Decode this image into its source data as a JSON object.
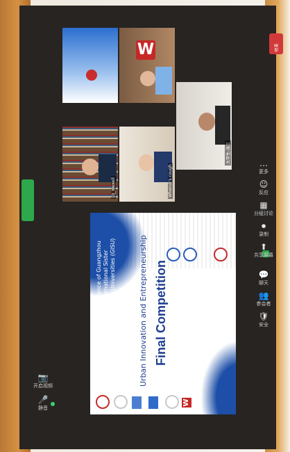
{
  "slide": {
    "host_line1": "Alliance of Guangzhou",
    "host_line2": "International Sister",
    "host_line3": "City Universities (GISU)",
    "title_line1": "Urban Innovation and Entrepreneurship",
    "title_line2": "Final Competition"
  },
  "participants": [
    {
      "name": "DJ_Wexell"
    },
    {
      "name": "Whendi's cough"
    },
    {
      "name": "大学生-张三"
    }
  ],
  "toolbar": {
    "items": [
      {
        "glyph": "🎤",
        "label": "静音"
      },
      {
        "glyph": "📷",
        "label": "开启视频"
      },
      {
        "glyph": "🛡",
        "label": "安全"
      },
      {
        "glyph": "👥",
        "label": "参会者"
      },
      {
        "glyph": "💬",
        "label": "聊天"
      },
      {
        "glyph": "⬆",
        "label": "共享屏幕"
      },
      {
        "glyph": "⏺",
        "label": "录制"
      },
      {
        "glyph": "▦",
        "label": "分组讨论"
      },
      {
        "glyph": "☺",
        "label": "反应"
      },
      {
        "glyph": "…",
        "label": "更多"
      }
    ],
    "end_label": "结束"
  },
  "colors": {
    "accent_blue": "#1d4fa8",
    "toolbar_green": "#2ea84a",
    "end_red": "#d23a3a",
    "screen_bg": "#272422"
  }
}
